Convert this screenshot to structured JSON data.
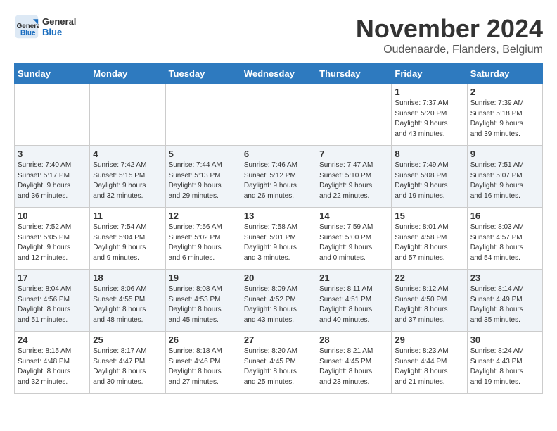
{
  "header": {
    "logo_line1": "General",
    "logo_line2": "Blue",
    "month": "November 2024",
    "location": "Oudenaarde, Flanders, Belgium"
  },
  "weekdays": [
    "Sunday",
    "Monday",
    "Tuesday",
    "Wednesday",
    "Thursday",
    "Friday",
    "Saturday"
  ],
  "weeks": [
    [
      {
        "day": "",
        "info": ""
      },
      {
        "day": "",
        "info": ""
      },
      {
        "day": "",
        "info": ""
      },
      {
        "day": "",
        "info": ""
      },
      {
        "day": "",
        "info": ""
      },
      {
        "day": "1",
        "info": "Sunrise: 7:37 AM\nSunset: 5:20 PM\nDaylight: 9 hours\nand 43 minutes."
      },
      {
        "day": "2",
        "info": "Sunrise: 7:39 AM\nSunset: 5:18 PM\nDaylight: 9 hours\nand 39 minutes."
      }
    ],
    [
      {
        "day": "3",
        "info": "Sunrise: 7:40 AM\nSunset: 5:17 PM\nDaylight: 9 hours\nand 36 minutes."
      },
      {
        "day": "4",
        "info": "Sunrise: 7:42 AM\nSunset: 5:15 PM\nDaylight: 9 hours\nand 32 minutes."
      },
      {
        "day": "5",
        "info": "Sunrise: 7:44 AM\nSunset: 5:13 PM\nDaylight: 9 hours\nand 29 minutes."
      },
      {
        "day": "6",
        "info": "Sunrise: 7:46 AM\nSunset: 5:12 PM\nDaylight: 9 hours\nand 26 minutes."
      },
      {
        "day": "7",
        "info": "Sunrise: 7:47 AM\nSunset: 5:10 PM\nDaylight: 9 hours\nand 22 minutes."
      },
      {
        "day": "8",
        "info": "Sunrise: 7:49 AM\nSunset: 5:08 PM\nDaylight: 9 hours\nand 19 minutes."
      },
      {
        "day": "9",
        "info": "Sunrise: 7:51 AM\nSunset: 5:07 PM\nDaylight: 9 hours\nand 16 minutes."
      }
    ],
    [
      {
        "day": "10",
        "info": "Sunrise: 7:52 AM\nSunset: 5:05 PM\nDaylight: 9 hours\nand 12 minutes."
      },
      {
        "day": "11",
        "info": "Sunrise: 7:54 AM\nSunset: 5:04 PM\nDaylight: 9 hours\nand 9 minutes."
      },
      {
        "day": "12",
        "info": "Sunrise: 7:56 AM\nSunset: 5:02 PM\nDaylight: 9 hours\nand 6 minutes."
      },
      {
        "day": "13",
        "info": "Sunrise: 7:58 AM\nSunset: 5:01 PM\nDaylight: 9 hours\nand 3 minutes."
      },
      {
        "day": "14",
        "info": "Sunrise: 7:59 AM\nSunset: 5:00 PM\nDaylight: 9 hours\nand 0 minutes."
      },
      {
        "day": "15",
        "info": "Sunrise: 8:01 AM\nSunset: 4:58 PM\nDaylight: 8 hours\nand 57 minutes."
      },
      {
        "day": "16",
        "info": "Sunrise: 8:03 AM\nSunset: 4:57 PM\nDaylight: 8 hours\nand 54 minutes."
      }
    ],
    [
      {
        "day": "17",
        "info": "Sunrise: 8:04 AM\nSunset: 4:56 PM\nDaylight: 8 hours\nand 51 minutes."
      },
      {
        "day": "18",
        "info": "Sunrise: 8:06 AM\nSunset: 4:55 PM\nDaylight: 8 hours\nand 48 minutes."
      },
      {
        "day": "19",
        "info": "Sunrise: 8:08 AM\nSunset: 4:53 PM\nDaylight: 8 hours\nand 45 minutes."
      },
      {
        "day": "20",
        "info": "Sunrise: 8:09 AM\nSunset: 4:52 PM\nDaylight: 8 hours\nand 43 minutes."
      },
      {
        "day": "21",
        "info": "Sunrise: 8:11 AM\nSunset: 4:51 PM\nDaylight: 8 hours\nand 40 minutes."
      },
      {
        "day": "22",
        "info": "Sunrise: 8:12 AM\nSunset: 4:50 PM\nDaylight: 8 hours\nand 37 minutes."
      },
      {
        "day": "23",
        "info": "Sunrise: 8:14 AM\nSunset: 4:49 PM\nDaylight: 8 hours\nand 35 minutes."
      }
    ],
    [
      {
        "day": "24",
        "info": "Sunrise: 8:15 AM\nSunset: 4:48 PM\nDaylight: 8 hours\nand 32 minutes."
      },
      {
        "day": "25",
        "info": "Sunrise: 8:17 AM\nSunset: 4:47 PM\nDaylight: 8 hours\nand 30 minutes."
      },
      {
        "day": "26",
        "info": "Sunrise: 8:18 AM\nSunset: 4:46 PM\nDaylight: 8 hours\nand 27 minutes."
      },
      {
        "day": "27",
        "info": "Sunrise: 8:20 AM\nSunset: 4:45 PM\nDaylight: 8 hours\nand 25 minutes."
      },
      {
        "day": "28",
        "info": "Sunrise: 8:21 AM\nSunset: 4:45 PM\nDaylight: 8 hours\nand 23 minutes."
      },
      {
        "day": "29",
        "info": "Sunrise: 8:23 AM\nSunset: 4:44 PM\nDaylight: 8 hours\nand 21 minutes."
      },
      {
        "day": "30",
        "info": "Sunrise: 8:24 AM\nSunset: 4:43 PM\nDaylight: 8 hours\nand 19 minutes."
      }
    ]
  ]
}
